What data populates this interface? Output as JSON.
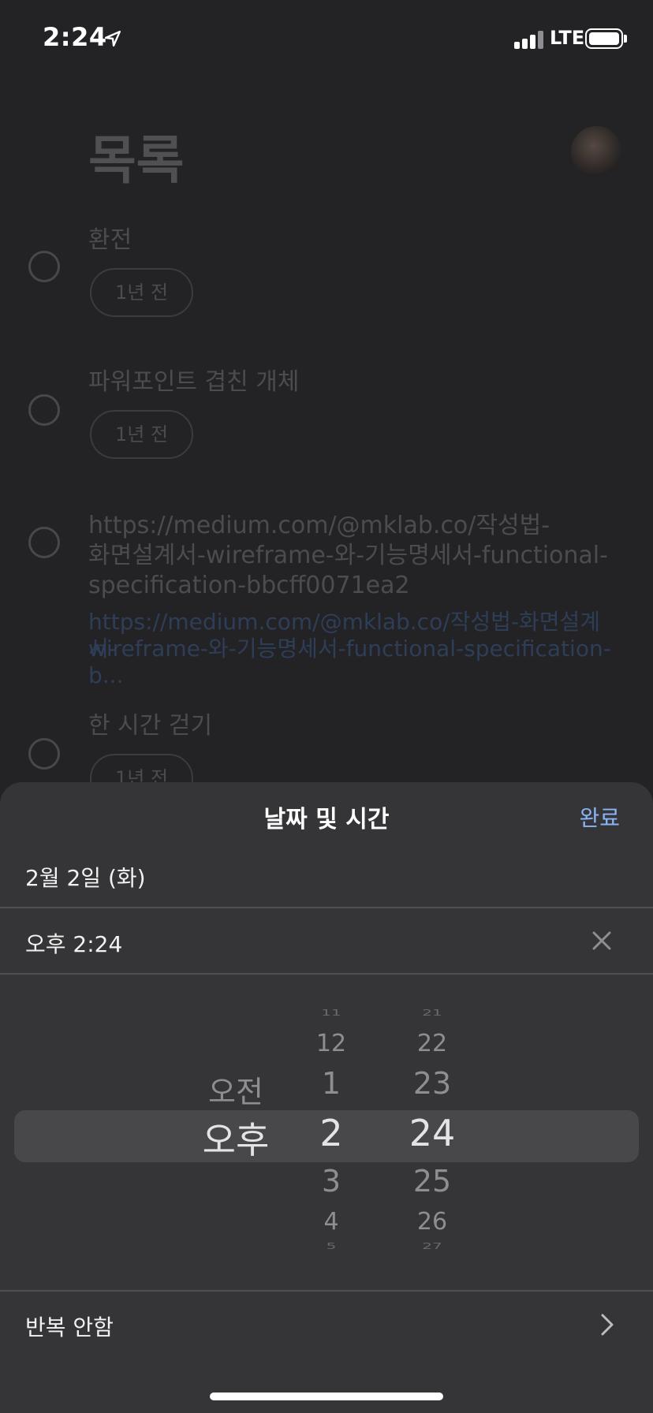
{
  "status_bar": {
    "time": "2:24",
    "network": "LTE"
  },
  "list": {
    "title": "목록",
    "items": [
      {
        "title": "환전",
        "chip": "1년 전"
      },
      {
        "title": "파워포인트 겹친 개체",
        "chip": "1년 전"
      },
      {
        "title_lines": [
          "https://medium.com/@mklab.co/작성법-",
          "화면설계서-wireframe-와-기능명세서-functional-",
          "specification-bbcff0071ea2"
        ],
        "link_lines": [
          "https://medium.com/@mklab.co/작성법-화면설계서-",
          "wireframe-와-기능명세서-functional-specification-b..."
        ]
      },
      {
        "title": "한 시간 걷기",
        "chip": "1년 전"
      }
    ]
  },
  "sheet": {
    "title": "날짜 및 시간",
    "done_label": "완료",
    "date_value": "2월 2일 (화)",
    "time_value": "오후 2:24",
    "repeat_label": "반복 안함"
  },
  "picker": {
    "period": {
      "above": "오전",
      "selected": "오후"
    },
    "hours": {
      "far_above": "11",
      "above2": "12",
      "above1": "1",
      "selected": "2",
      "below1": "3",
      "below2": "4",
      "far_below": "5"
    },
    "minutes": {
      "far_above": "21",
      "above2": "22",
      "above1": "23",
      "selected": "24",
      "below1": "25",
      "below2": "26",
      "far_below": "27"
    }
  },
  "colors": {
    "background": "#232325",
    "sheet": "#353537",
    "accent": "#8ab4f8"
  },
  "icons": [
    "location-arrow-icon",
    "signal-icon",
    "battery-icon",
    "clear-icon",
    "chevron-right-icon"
  ]
}
